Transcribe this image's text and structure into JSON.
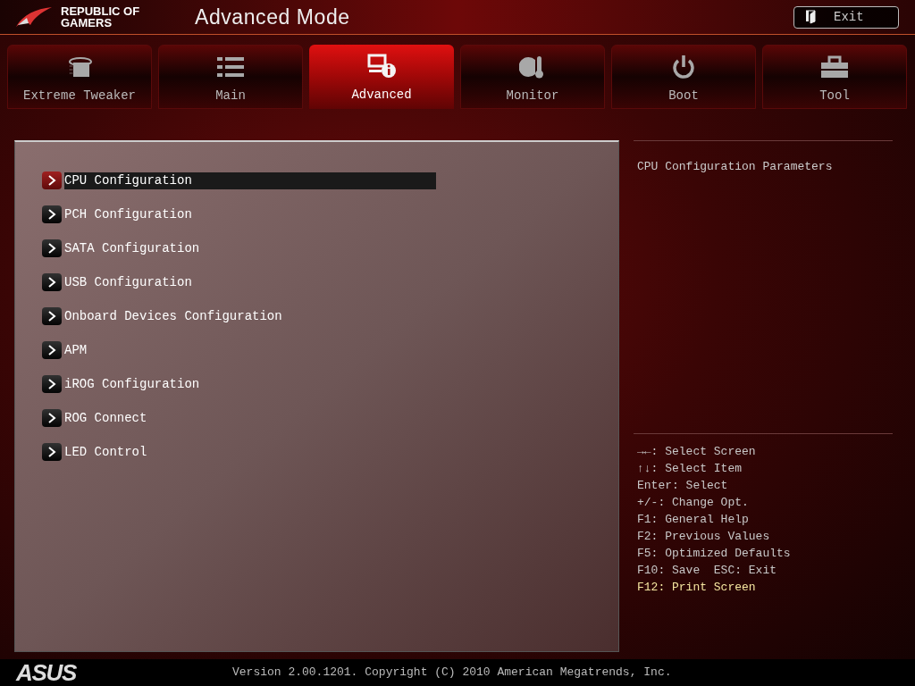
{
  "header": {
    "brand": [
      "REPUBLIC OF",
      "GAMERS"
    ],
    "title": "Advanced Mode",
    "exit_button": "Exit"
  },
  "tabs": [
    {
      "label": "Extreme Tweaker",
      "kind": "tweaker",
      "selected": false
    },
    {
      "label": "Main",
      "kind": "list",
      "selected": false
    },
    {
      "label": "Advanced",
      "kind": "info",
      "selected": true
    },
    {
      "label": "Monitor",
      "kind": "gauge",
      "selected": false
    },
    {
      "label": "Boot",
      "kind": "power",
      "selected": false
    },
    {
      "label": "Tool",
      "kind": "toolbox",
      "selected": false
    }
  ],
  "menu": [
    {
      "label": "CPU Configuration",
      "selected": true
    },
    {
      "label": "PCH Configuration",
      "selected": false
    },
    {
      "label": "SATA Configuration",
      "selected": false
    },
    {
      "label": "USB Configuration",
      "selected": false
    },
    {
      "label": "Onboard Devices Configuration",
      "selected": false
    },
    {
      "label": "APM",
      "selected": false
    },
    {
      "label": "iROG Configuration",
      "selected": false
    },
    {
      "label": "ROG Connect",
      "selected": false
    },
    {
      "label": "LED Control",
      "selected": false
    }
  ],
  "description": "CPU Configuration Parameters",
  "help": [
    {
      "text": "→←: Select Screen",
      "highlighted": false
    },
    {
      "text": "↑↓: Select Item",
      "highlighted": false
    },
    {
      "text": "Enter: Select",
      "highlighted": false
    },
    {
      "text": "+/-: Change Opt.",
      "highlighted": false
    },
    {
      "text": "F1: General Help",
      "highlighted": false
    },
    {
      "text": "F2: Previous Values",
      "highlighted": false
    },
    {
      "text": "F5: Optimized Defaults",
      "highlighted": false
    },
    {
      "text": "F10: Save  ESC: Exit",
      "highlighted": false
    },
    {
      "text": "F12: Print Screen",
      "highlighted": true
    }
  ],
  "footer": {
    "logo": "ASUS",
    "version": "Version 2.00.1201. Copyright (C) 2010 American Megatrends, Inc."
  }
}
